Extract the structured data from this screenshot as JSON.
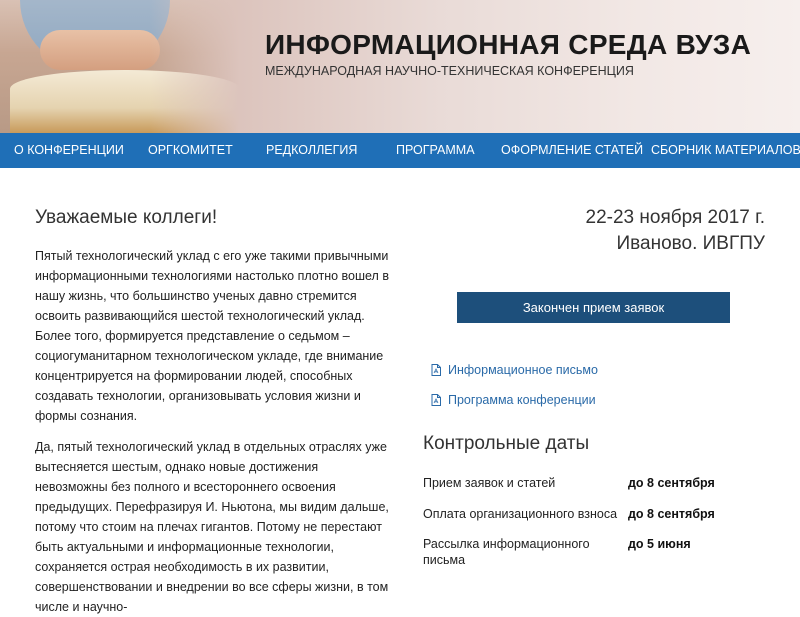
{
  "header": {
    "title": "ИНФОРМАЦИОННАЯ СРЕДА ВУЗА",
    "subtitle": "МЕЖДУНАРОДНАЯ НАУЧНО-ТЕХНИЧЕСКАЯ КОНФЕРЕНЦИЯ"
  },
  "nav": {
    "items": [
      {
        "label": "О КОНФЕРЕНЦИИ"
      },
      {
        "label": "ОРГКОМИТЕТ"
      },
      {
        "label": "РЕДКОЛЛЕГИЯ"
      },
      {
        "label": "ПРОГРАММА"
      },
      {
        "label": "ОФОРМЛЕНИЕ СТАТЕЙ"
      },
      {
        "label": "СБОРНИК МАТЕРИАЛОВ"
      }
    ]
  },
  "main": {
    "welcome_title": "Уважаемые коллеги!",
    "paragraph1": "Пятый технологический уклад с его уже такими привычными информационными технологиями настолько плотно вошел в нашу жизнь, что большинство ученых давно стремится освоить развивающийся шестой технологический уклад. Более того, формируется представление о седьмом – социогуманитарном технологическом укладе, где внимание концентрируется на формировании людей, способных создавать технологии, организовывать условия жизни и формы сознания.",
    "paragraph2": "Да, пятый технологический уклад в отдельных отраслях уже вытесняется шестым, однако новые достижения невозможны без полного и всестороннего освоения предыдущих. Перефразируя И. Ньютона, мы видим дальше, потому что стоим на плечах гигантов. Потому не перестают быть актуальными и информационные технологии, сохраняется острая необходимость в их развитии, совершенствовании и внедрении во все сферы жизни, в том числе и научно-"
  },
  "sidebar": {
    "date": "22-23 ноября 2017 г.",
    "place": "Иваново. ИВГПУ",
    "button_label": "Закончен прием заявок",
    "links": [
      {
        "label": "Информационное письмо",
        "icon": "pdf-icon"
      },
      {
        "label": "Программа конференции",
        "icon": "pdf-icon"
      }
    ],
    "dates_title": "Контрольные даты",
    "dates": [
      {
        "label": "Прием заявок и статей",
        "value": "до 8 сентября"
      },
      {
        "label": "Оплата организационного взноса",
        "value": "до 8 сентября"
      },
      {
        "label": "Рассылка информационного письма",
        "value": "до 5 июня"
      }
    ]
  },
  "colors": {
    "nav_bg": "#1f6fb7",
    "button_bg": "#1d4f7b",
    "link": "#2a6aa8"
  }
}
